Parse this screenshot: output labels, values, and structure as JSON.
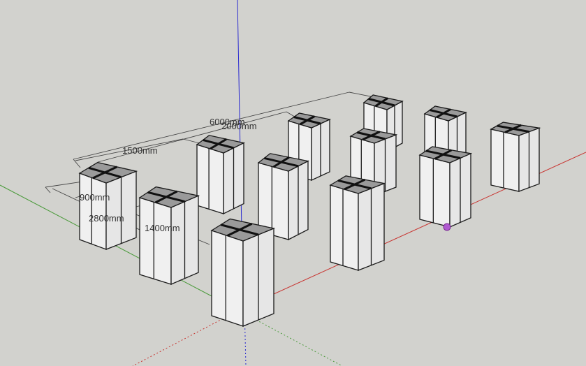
{
  "app": {
    "view": "3D model viewport"
  },
  "dimensions": [
    {
      "id": "dim-6000",
      "label": "6000mm"
    },
    {
      "id": "dim-2000",
      "label": "2000mm"
    },
    {
      "id": "dim-1500",
      "label": "1500mm"
    },
    {
      "id": "dim-900",
      "label": "900mm"
    },
    {
      "id": "dim-2800",
      "label": "2800mm"
    },
    {
      "id": "dim-1400",
      "label": "1400mm"
    }
  ],
  "colors": {
    "background": "#d2d2ce",
    "axis_red": "#c8332f",
    "axis_green": "#4a9a3a",
    "axis_blue": "#2a2ad0",
    "inference_point": "#b05ad0",
    "column_face": "#f0f0f0",
    "column_top": "#9a9a9a"
  },
  "columns_count": 12
}
